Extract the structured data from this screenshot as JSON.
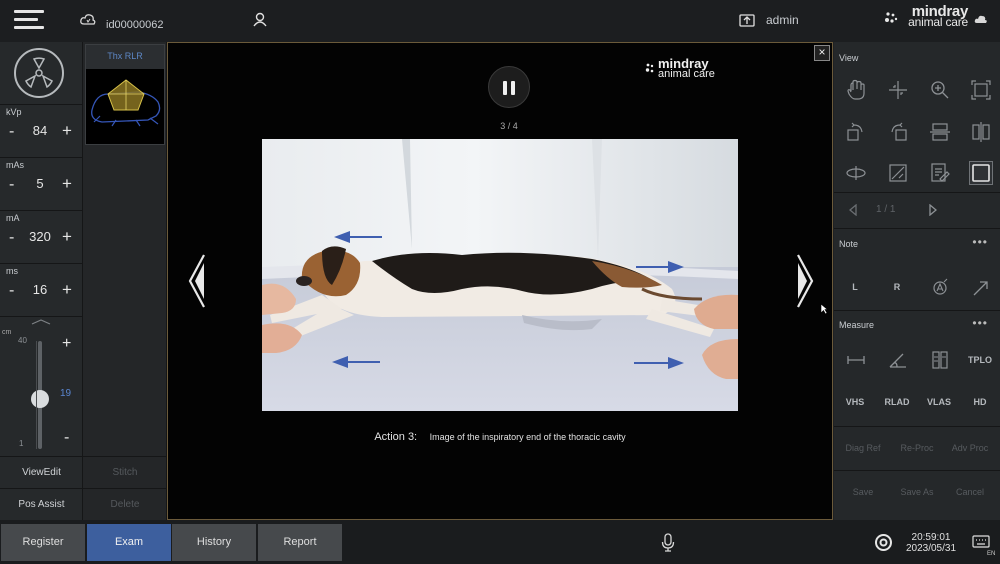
{
  "topbar": {
    "patient_id": "id00000062",
    "user": "admin",
    "brand_line1": "mindray",
    "brand_line2": "animal care"
  },
  "left_params": [
    {
      "label": "kVp",
      "value": "84"
    },
    {
      "label": "mAs",
      "value": "5"
    },
    {
      "label": "mA",
      "value": "320"
    },
    {
      "label": "ms",
      "value": "16"
    }
  ],
  "slider": {
    "unit": "cm",
    "max_label": "40",
    "min_label": "1",
    "value": "19",
    "value_numeric": 19,
    "max": 40,
    "min": 1
  },
  "left_buttons": {
    "view_edit": "ViewEdit",
    "pos_assist": "Pos Assist"
  },
  "thumbnails": [
    {
      "label": "Thx RLR"
    }
  ],
  "thumb_buttons": {
    "stitch": "Stitch",
    "delete": "Delete"
  },
  "viewer": {
    "counter": "3 / 4",
    "logo_line1": "mindray",
    "logo_line2": "animal care",
    "caption_label": "Action 3:",
    "caption_text": "Image of the inspiratory end of the thoracic cavity",
    "close": "×"
  },
  "right_panel": {
    "view_title": "View",
    "page_indicator": "1 / 1",
    "note_title": "Note",
    "note_tools": [
      "L",
      "R"
    ],
    "measure_title": "Measure",
    "measure_tools_row1_text": "TPLO",
    "measure_tools_row2": [
      "VHS",
      "RLAD",
      "VLAS",
      "HD"
    ],
    "proc_buttons": [
      "Diag Ref",
      "Re-Proc",
      "Adv Proc"
    ],
    "save_buttons": [
      "Save",
      "Save As",
      "Cancel"
    ]
  },
  "bottom_tabs": [
    {
      "label": "Register",
      "active": false
    },
    {
      "label": "Exam",
      "active": true
    },
    {
      "label": "History",
      "active": false
    },
    {
      "label": "Report",
      "active": false
    }
  ],
  "status": {
    "time": "20:59:01",
    "date": "2023/05/31",
    "lang": "EN"
  },
  "colors": {
    "accent": "#3d5f9e",
    "tab": "#46494c",
    "arrow_blue": "#3f5fb0"
  }
}
